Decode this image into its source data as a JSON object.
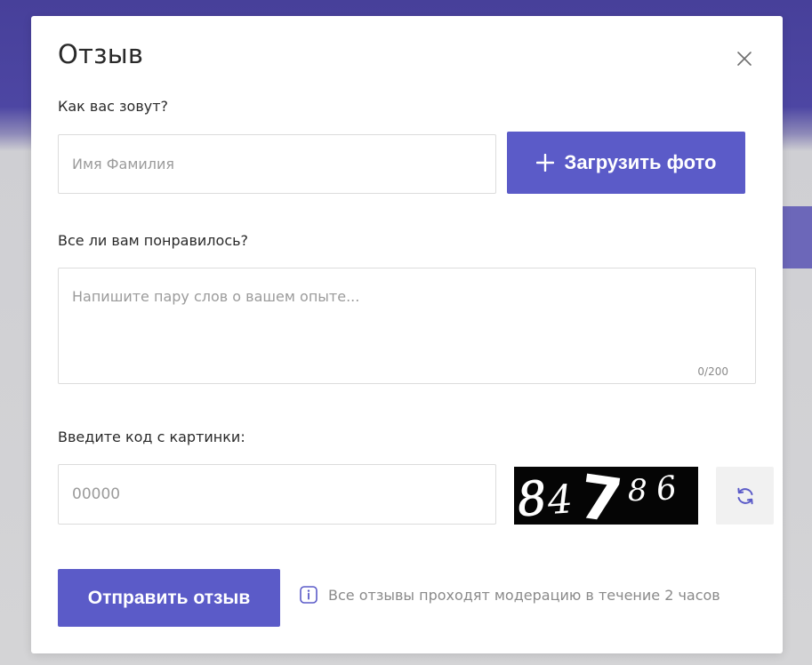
{
  "dialog": {
    "title": "Отзыв"
  },
  "name_field": {
    "label": "Как вас зовут?",
    "placeholder": "Имя Фамилия",
    "value": ""
  },
  "upload": {
    "label": "Загрузить фото",
    "icon": "plus-icon"
  },
  "review_field": {
    "label": "Все ли вам понравилось?",
    "placeholder": "Напишите пару слов о вашем опыте...",
    "value": "",
    "counter": "0/200"
  },
  "captcha": {
    "label": "Введите код с картинки:",
    "placeholder": "00000",
    "value": "",
    "image_code": "84786",
    "refresh_icon": "refresh-icon"
  },
  "submit": {
    "label": "Отправить отзыв"
  },
  "note": {
    "icon": "info-icon",
    "text": "Все отзывы проходят модерацию в течение 2 часов"
  },
  "colors": {
    "accent": "#5b5bc8",
    "backdrop": "#47409a",
    "text": "#2a2a2a",
    "muted": "#8a8a8a",
    "border": "#dcdcdc"
  }
}
